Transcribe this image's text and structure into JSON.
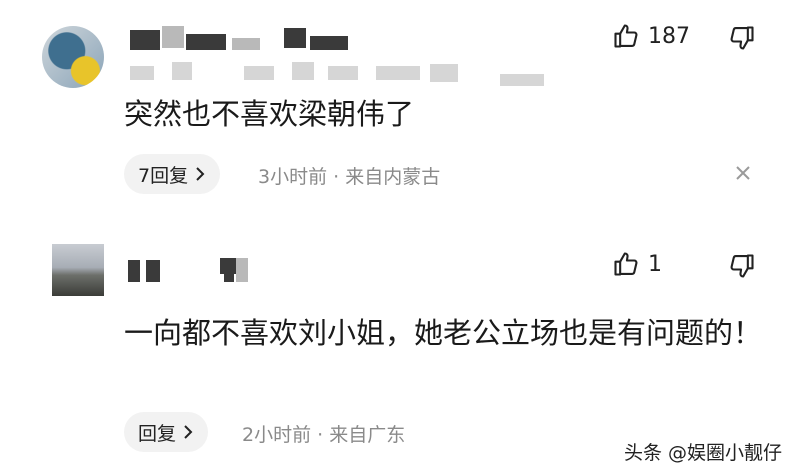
{
  "comments": [
    {
      "like_count": "187",
      "text": "突然也不喜欢梁朝伟了",
      "reply_label": "7回复",
      "meta": "3小时前 · 来自内蒙古"
    },
    {
      "like_count": "1",
      "text": "一向都不喜欢刘小姐，她老公立场也是有问题的！",
      "reply_label": "回复",
      "meta": "2小时前 · 来自广东"
    }
  ],
  "watermark": "头条 @娱圈小靓仔",
  "icons": {
    "like": "thumbs-up-icon",
    "dislike": "thumbs-down-icon",
    "chevron": "chevron-right-icon",
    "close": "close-icon"
  }
}
